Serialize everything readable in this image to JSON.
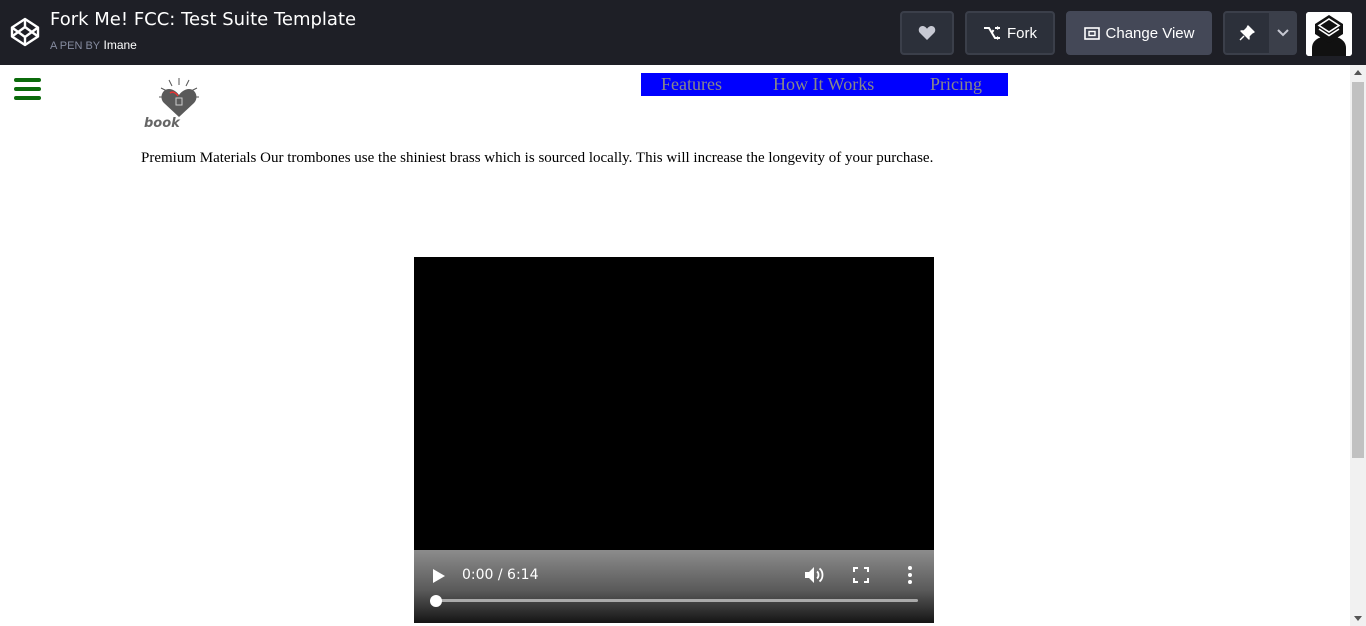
{
  "header": {
    "title": "Fork Me! FCC: Test Suite Template",
    "byline_prefix": "A PEN BY",
    "author": "Imane",
    "fork_label": "Fork",
    "change_view_label": "Change View",
    "icons": [
      "codepen-logo-icon",
      "heart-icon",
      "fork-icon",
      "change-view-icon",
      "pin-icon",
      "chevron-down-icon",
      "user-avatar"
    ]
  },
  "page": {
    "brand_text": "book",
    "nav_links": [
      "Features",
      "How It Works",
      "Pricing"
    ],
    "nav_bg_color": "#0000ff",
    "menu_color": "#0b6b0b",
    "feature_text": "Premium Materials Our trombones use the shiniest brass which is sourced locally. This will increase the longevity of your purchase."
  },
  "video": {
    "time": "0:00 / 6:14",
    "progress": 0
  }
}
